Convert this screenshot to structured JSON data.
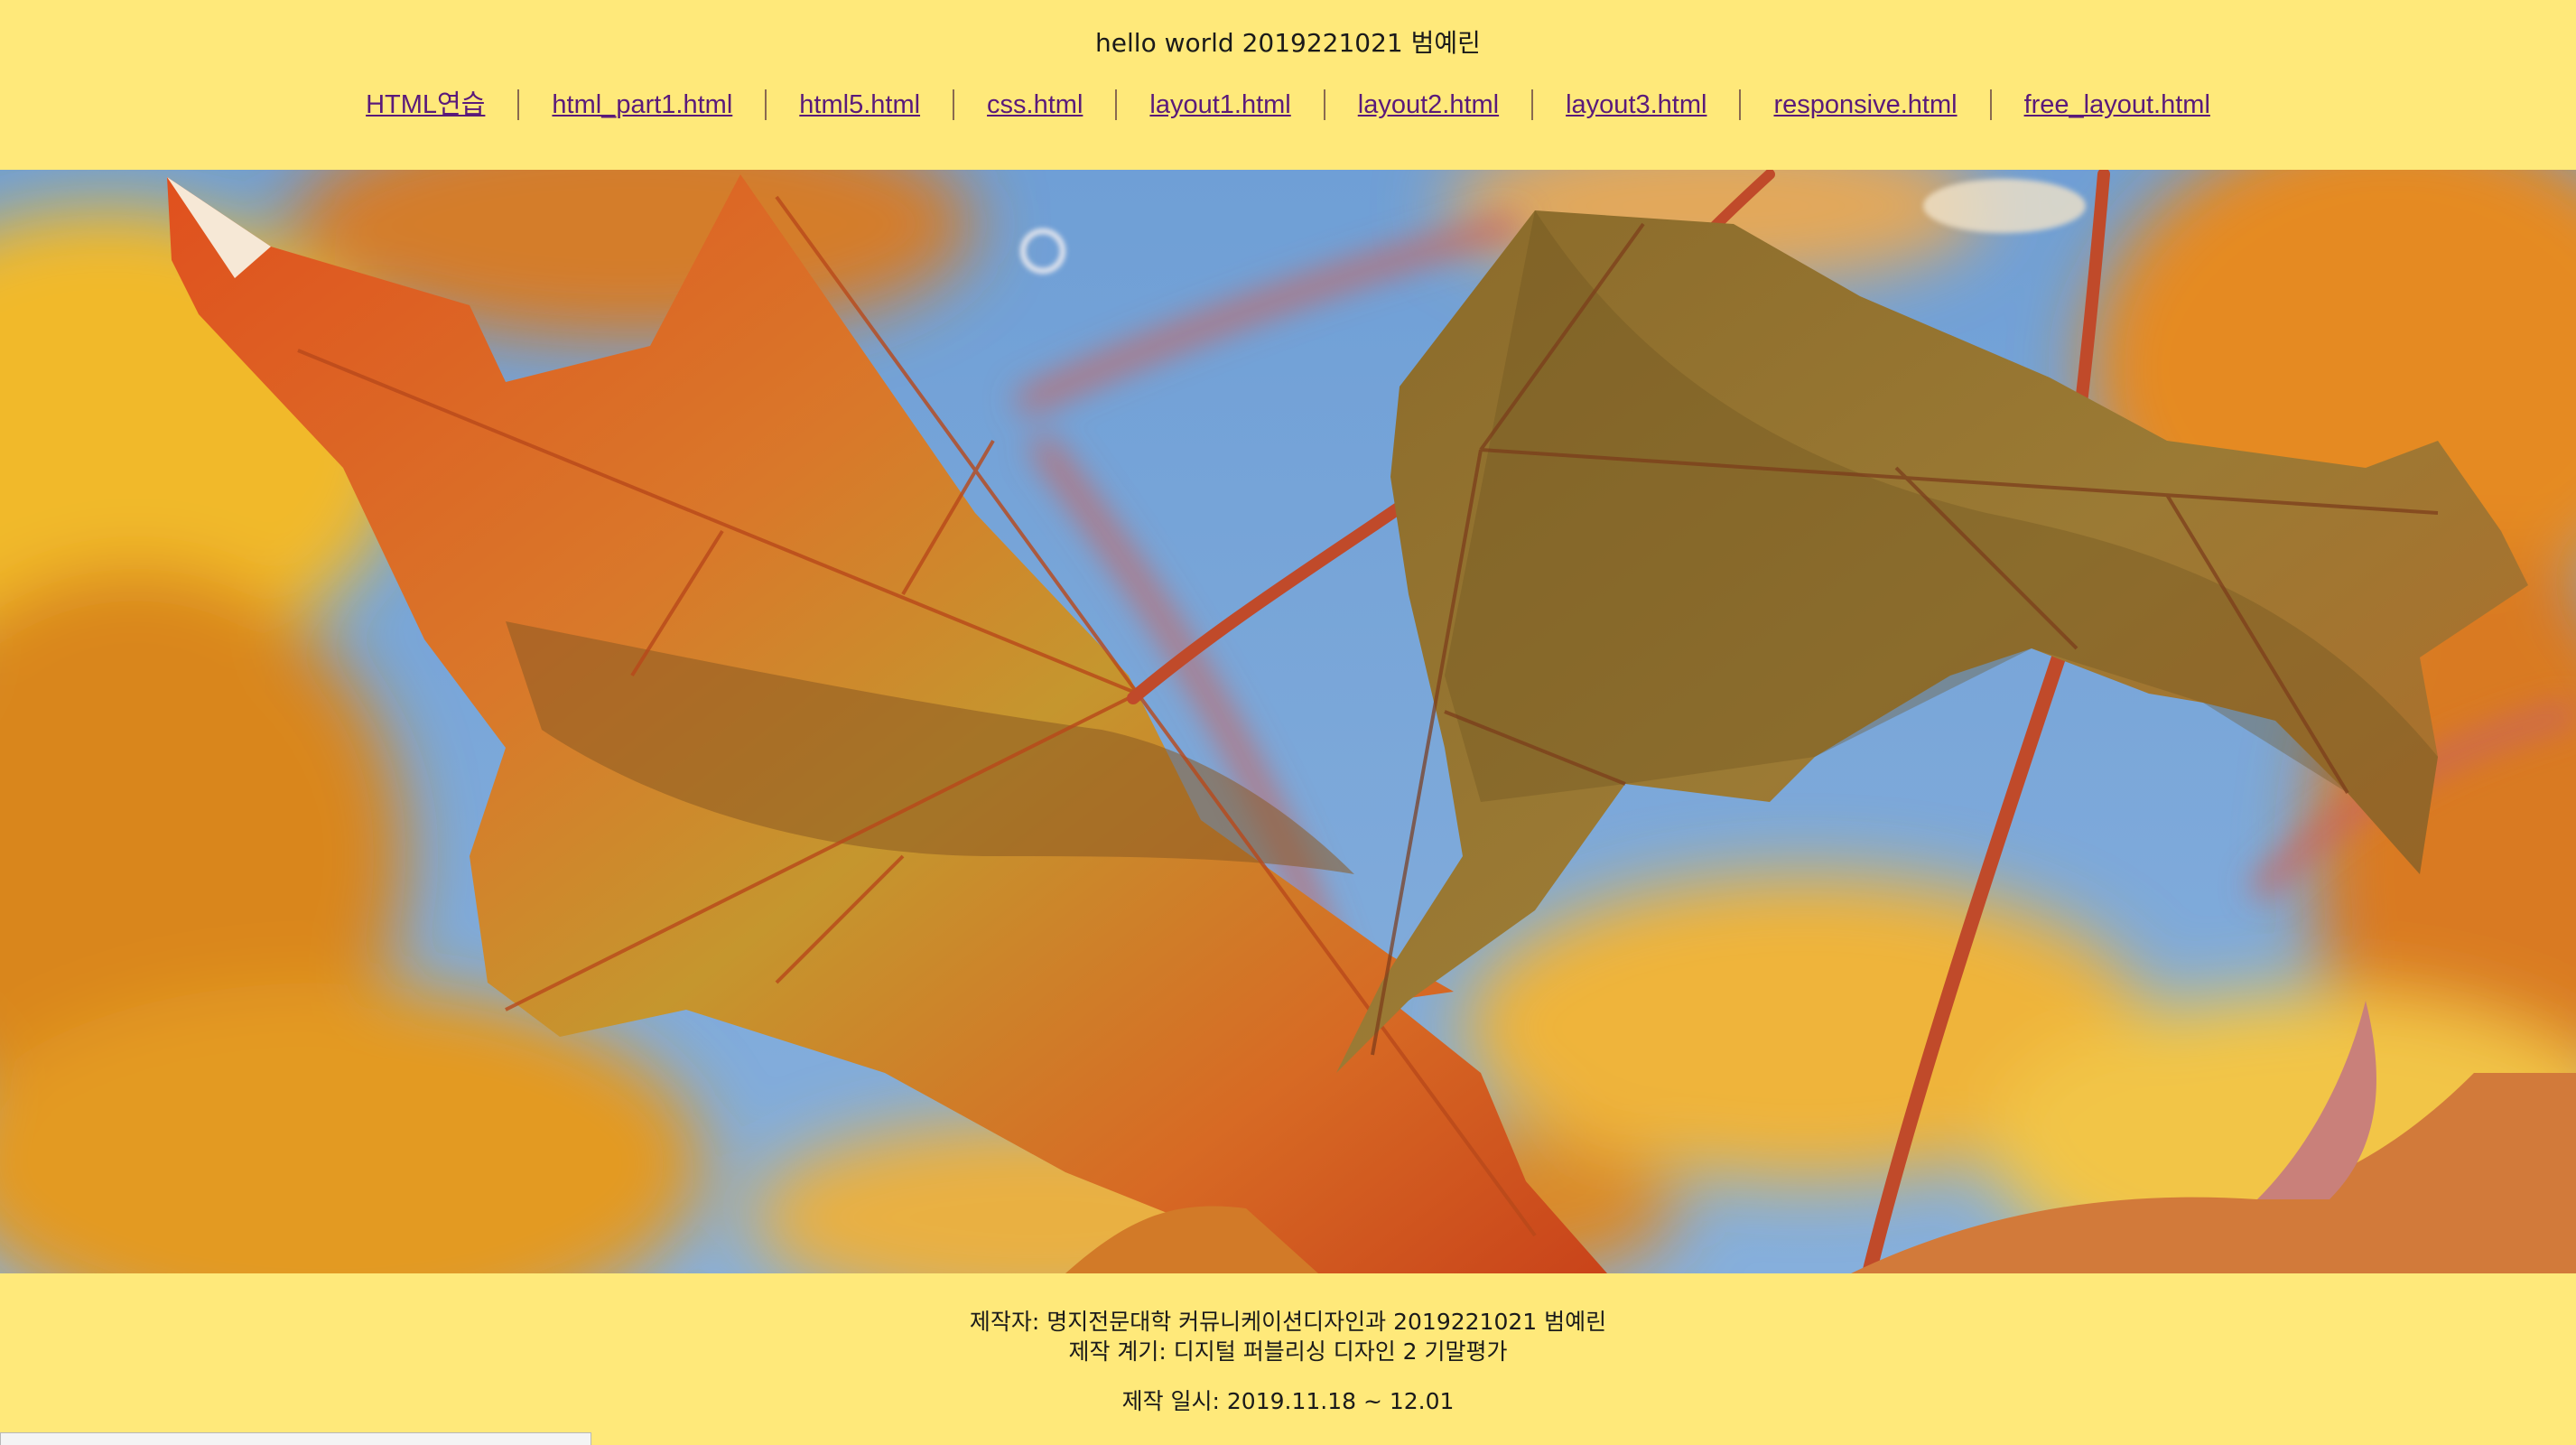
{
  "header": {
    "title": "hello world 2019221021 범예린"
  },
  "nav": {
    "links": [
      {
        "label": "HTML연습"
      },
      {
        "label": "html_part1.html"
      },
      {
        "label": "html5.html"
      },
      {
        "label": "css.html"
      },
      {
        "label": "layout1.html"
      },
      {
        "label": "layout2.html"
      },
      {
        "label": "layout3.html"
      },
      {
        "label": "responsive.html"
      },
      {
        "label": "free_layout.html"
      }
    ]
  },
  "hero": {
    "image_alt": "autumn maple leaves against blue sky"
  },
  "footer": {
    "author": "제작자: 명지전문대학 커뮤니케이션디자인과 2019221021 범예린",
    "reason": "제작 계기: 디지털 퍼블리싱 디자인 2 기말평가",
    "date": "제작 일시: 2019.11.18 ~ 12.01"
  },
  "colors": {
    "page_bg": "#ffe97a",
    "link": "#5a1a7a",
    "sky": "#7aa6d8"
  }
}
